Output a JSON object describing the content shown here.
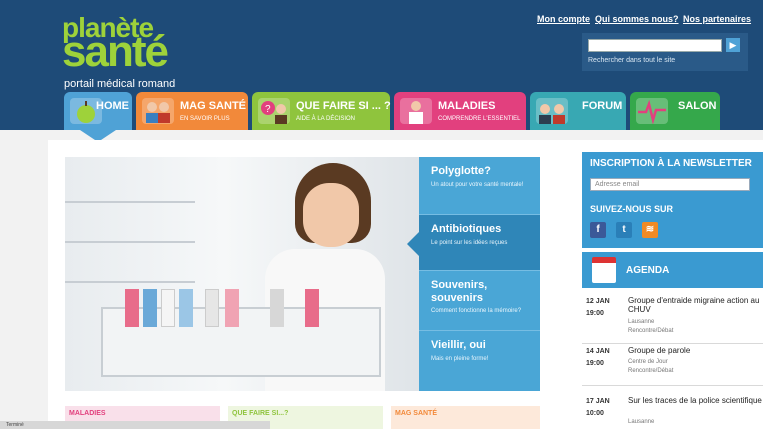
{
  "header": {
    "logo": {
      "line1": "planète",
      "line2": "santé",
      "tagline": "portail médical romand"
    },
    "top_links": [
      "Mon compte",
      "Qui sommes nous?",
      "Nos partenaires"
    ],
    "search": {
      "placeholder": "",
      "hint": "Rechercher dans tout le site",
      "button_icon": "play-arrow-icon"
    }
  },
  "nav": {
    "tabs": [
      {
        "label": "HOME",
        "sub": "",
        "color": "#4fa2d6",
        "icon": "apple-icon"
      },
      {
        "label": "MAG SANTÉ",
        "sub": "EN SAVOIR PLUS",
        "color": "#f2893a",
        "icon": "people-icon"
      },
      {
        "label": "QUE FAIRE SI ... ?",
        "sub": "AIDE À LA DÉCISION",
        "color": "#8fc43d",
        "icon": "question-person-icon"
      },
      {
        "label": "MALADIES",
        "sub": "COMPRENDRE L'ESSENTIEL",
        "color": "#e2407e",
        "icon": "doctor-icon"
      },
      {
        "label": "FORUM",
        "sub": "",
        "color": "#38a8b3",
        "icon": "chat-people-icon"
      },
      {
        "label": "SALON",
        "sub": "",
        "color": "#35a84b",
        "icon": "heartbeat-icon"
      }
    ]
  },
  "hero_panel": {
    "items": [
      {
        "title": "Polyglotte?",
        "sub": "Un atout pour votre santé mentale!"
      },
      {
        "title": "Antibiotiques",
        "sub": "Le point sur les idées reçues"
      },
      {
        "title": "Souvenirs, souvenirs",
        "sub": "Comment fonctionne la mémoire?"
      },
      {
        "title": "Vieillir, oui",
        "sub": "Mais en pleine forme!"
      }
    ]
  },
  "newsletter": {
    "title": "INSCRIPTION À LA NEWSLETTER",
    "email_placeholder": "Adresse email",
    "follow_title": "SUIVEZ-NOUS SUR",
    "socials": [
      "facebook-icon",
      "twitter-icon",
      "rss-icon"
    ]
  },
  "agenda": {
    "title": "AGENDA",
    "items": [
      {
        "date": "12 JAN",
        "time": "19:00",
        "title": "Groupe d'entraide migraine action au CHUV",
        "place": "Lausanne",
        "type": "Rencontre/Débat"
      },
      {
        "date": "14 JAN",
        "time": "19:00",
        "title": "Groupe de parole",
        "place": "Centre de Jour",
        "type": "Rencontre/Débat"
      },
      {
        "date": "17 JAN",
        "time": "10:00",
        "title": "Sur les traces de la police scientifique",
        "place": "Lausanne",
        "type": ""
      }
    ]
  },
  "bottom_tabs": [
    {
      "label": "MALADIES",
      "color": "#e2407e",
      "bg": "#f9e0ea"
    },
    {
      "label": "QUE FAIRE SI...?",
      "color": "#8fc43d",
      "bg": "#eef6e0"
    },
    {
      "label": "MAG SANTÉ",
      "color": "#f2893a",
      "bg": "#fde9da"
    }
  ],
  "status": {
    "text": "Terminé"
  }
}
